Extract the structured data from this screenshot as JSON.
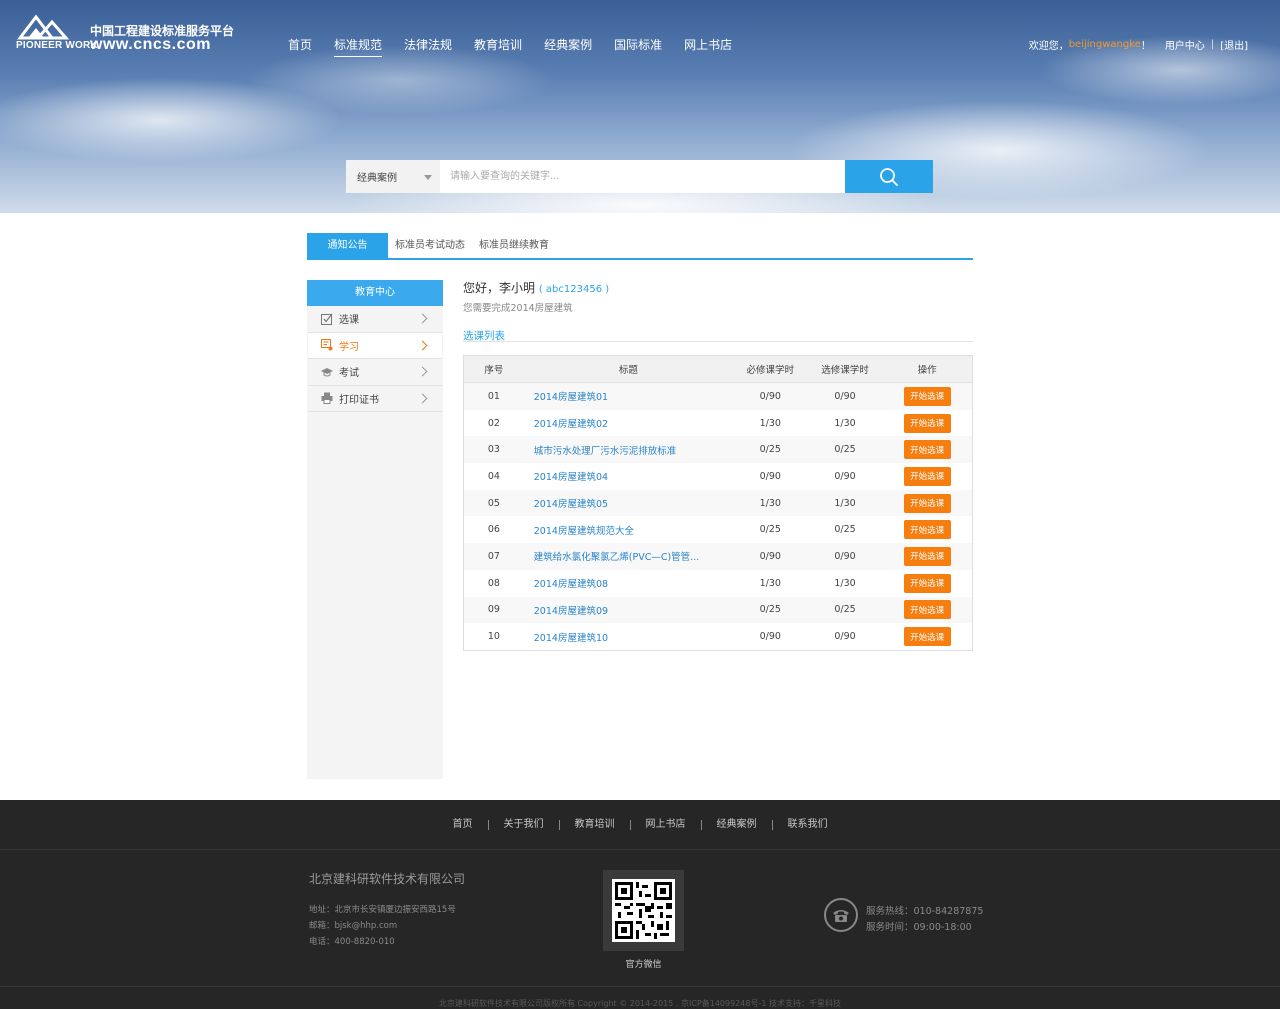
{
  "header": {
    "logo_en": "PIONEER WORK",
    "logo_cn": "中国工程建设标准服务平台",
    "logo_url": "www.cncs.com",
    "nav": [
      "首页",
      "标准规范",
      "法律法规",
      "教育培训",
      "经典案例",
      "国际标准",
      "网上书店"
    ],
    "nav_active": "标准规范",
    "user": {
      "welcome": "欢迎您，",
      "username": "beijingwangke",
      "suffix": "！",
      "center": "用户中心",
      "logout": "[退出]"
    }
  },
  "search": {
    "category": "经典案例",
    "placeholder": "请输入要查询的关键字..."
  },
  "tabs": [
    "通知公告",
    "标准员考试动态",
    "标准员继续教育"
  ],
  "sidebar": {
    "title": "教育中心",
    "items": [
      {
        "label": "选课",
        "icon": "checkbox-icon"
      },
      {
        "label": "学习",
        "icon": "study-icon",
        "active": true
      },
      {
        "label": "考试",
        "icon": "graduation-cap-icon"
      },
      {
        "label": "打印证书",
        "icon": "printer-icon"
      }
    ]
  },
  "main": {
    "greeting": "您好，李小明",
    "account": "( abc123456 )",
    "task": "您需要完成2014房屋建筑",
    "section_title": "选课列表",
    "table": {
      "headers": [
        "序号",
        "标题",
        "必修课学时",
        "选修课学时",
        "操作"
      ],
      "action_label": "开始选课",
      "rows": [
        {
          "no": "01",
          "title": "2014房屋建筑01",
          "required": "0/90",
          "elective": "0/90"
        },
        {
          "no": "02",
          "title": "2014房屋建筑02",
          "required": "1/30",
          "elective": "1/30"
        },
        {
          "no": "03",
          "title": "城市污水处理厂污水污泥排放标准",
          "required": "0/25",
          "elective": "0/25"
        },
        {
          "no": "04",
          "title": "2014房屋建筑04",
          "required": "0/90",
          "elective": "0/90"
        },
        {
          "no": "05",
          "title": "2014房屋建筑05",
          "required": "1/30",
          "elective": "1/30"
        },
        {
          "no": "06",
          "title": "2014房屋建筑规范大全",
          "required": "0/25",
          "elective": "0/25"
        },
        {
          "no": "07",
          "title": "建筑给水氯化聚氯乙烯(PVC—C)管管...",
          "required": "0/90",
          "elective": "0/90"
        },
        {
          "no": "08",
          "title": "2014房屋建筑08",
          "required": "1/30",
          "elective": "1/30"
        },
        {
          "no": "09",
          "title": "2014房屋建筑09",
          "required": "0/25",
          "elective": "0/25"
        },
        {
          "no": "10",
          "title": "2014房屋建筑10",
          "required": "0/90",
          "elective": "0/90"
        }
      ]
    }
  },
  "footer": {
    "nav": [
      "首页",
      "关于我们",
      "教育培训",
      "网上书店",
      "经典案例",
      "联系我们"
    ],
    "company": "北京建科研软件技术有限公司",
    "address": "地址：北京市长安镇厦边振安西路15号",
    "email": "邮箱：bjsk@hhp.com",
    "phone": "电话：400-8820-010",
    "qr_label": "官方微信",
    "hotline": "服务热线：010-84287875",
    "hours": "服务时间：09:00-18:00",
    "copyright": "北京建科研软件技术有限公司版权所有    Copyright © 2014-2015 . 京ICP备14099248号-1  技术支持：千星科技"
  },
  "colors": {
    "accent": "#2ba3e8",
    "action": "#f57e0f",
    "username": "#f39a2e",
    "footer_bg": "#262626"
  }
}
